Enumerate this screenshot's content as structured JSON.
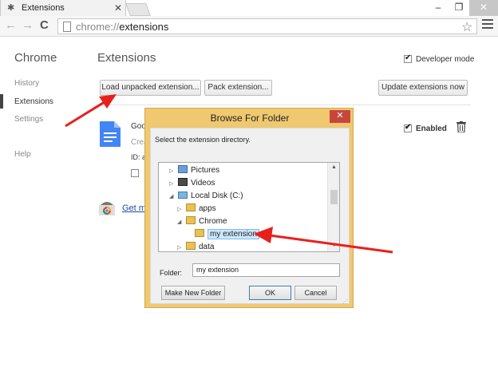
{
  "window": {
    "tab_title": "Extensions",
    "tab_close": "✕",
    "minimize": "–",
    "maximize": "❐",
    "close": "✕"
  },
  "toolbar": {
    "back": "←",
    "forward": "→",
    "reload": "C",
    "url_scheme": "chrome://",
    "url_host": "extensions"
  },
  "sidebar": {
    "title": "Chrome",
    "items": [
      {
        "label": "History"
      },
      {
        "label": "Extensions",
        "active": true
      },
      {
        "label": "Settings"
      },
      {
        "label": "Help"
      }
    ]
  },
  "main": {
    "title": "Extensions",
    "developer_mode_label": "Developer mode",
    "developer_mode_checked": true,
    "buttons": {
      "load_unpacked": "Load unpacked extension...",
      "pack": "Pack extension...",
      "update": "Update extensions now"
    },
    "extension": {
      "name_partial": "Goo",
      "desc_partial": "Crea",
      "id_partial": "ID: a",
      "enabled_label": "Enabled",
      "enabled_checked": true
    },
    "gallery_link_partial": "Get m"
  },
  "dialog": {
    "title": "Browse For Folder",
    "close": "✕",
    "prompt": "Select the extension directory.",
    "tree": [
      {
        "label": "Pictures",
        "expander": "▷",
        "icon": "pictures"
      },
      {
        "label": "Videos",
        "expander": "▷",
        "icon": "videos"
      },
      {
        "label": "Local Disk (C:)",
        "expander": "◢",
        "icon": "disk"
      },
      {
        "label": "apps",
        "expander": "▷",
        "icon": "folder"
      },
      {
        "label": "Chrome",
        "expander": "◢",
        "icon": "folder"
      },
      {
        "label": "my extension",
        "expander": "",
        "icon": "folder",
        "selected": true
      },
      {
        "label": "data",
        "expander": "▷",
        "icon": "folder"
      }
    ],
    "folder_label": "Folder:",
    "folder_value": "my extension",
    "buttons": {
      "make_new_folder": "Make New Folder",
      "ok": "OK",
      "cancel": "Cancel"
    }
  },
  "colors": {
    "dialog_frame": "#f0c870",
    "dialog_close": "#c7463b",
    "arrow": "#e8201c",
    "link": "#1a4ea8",
    "selection": "#cde8ff"
  }
}
